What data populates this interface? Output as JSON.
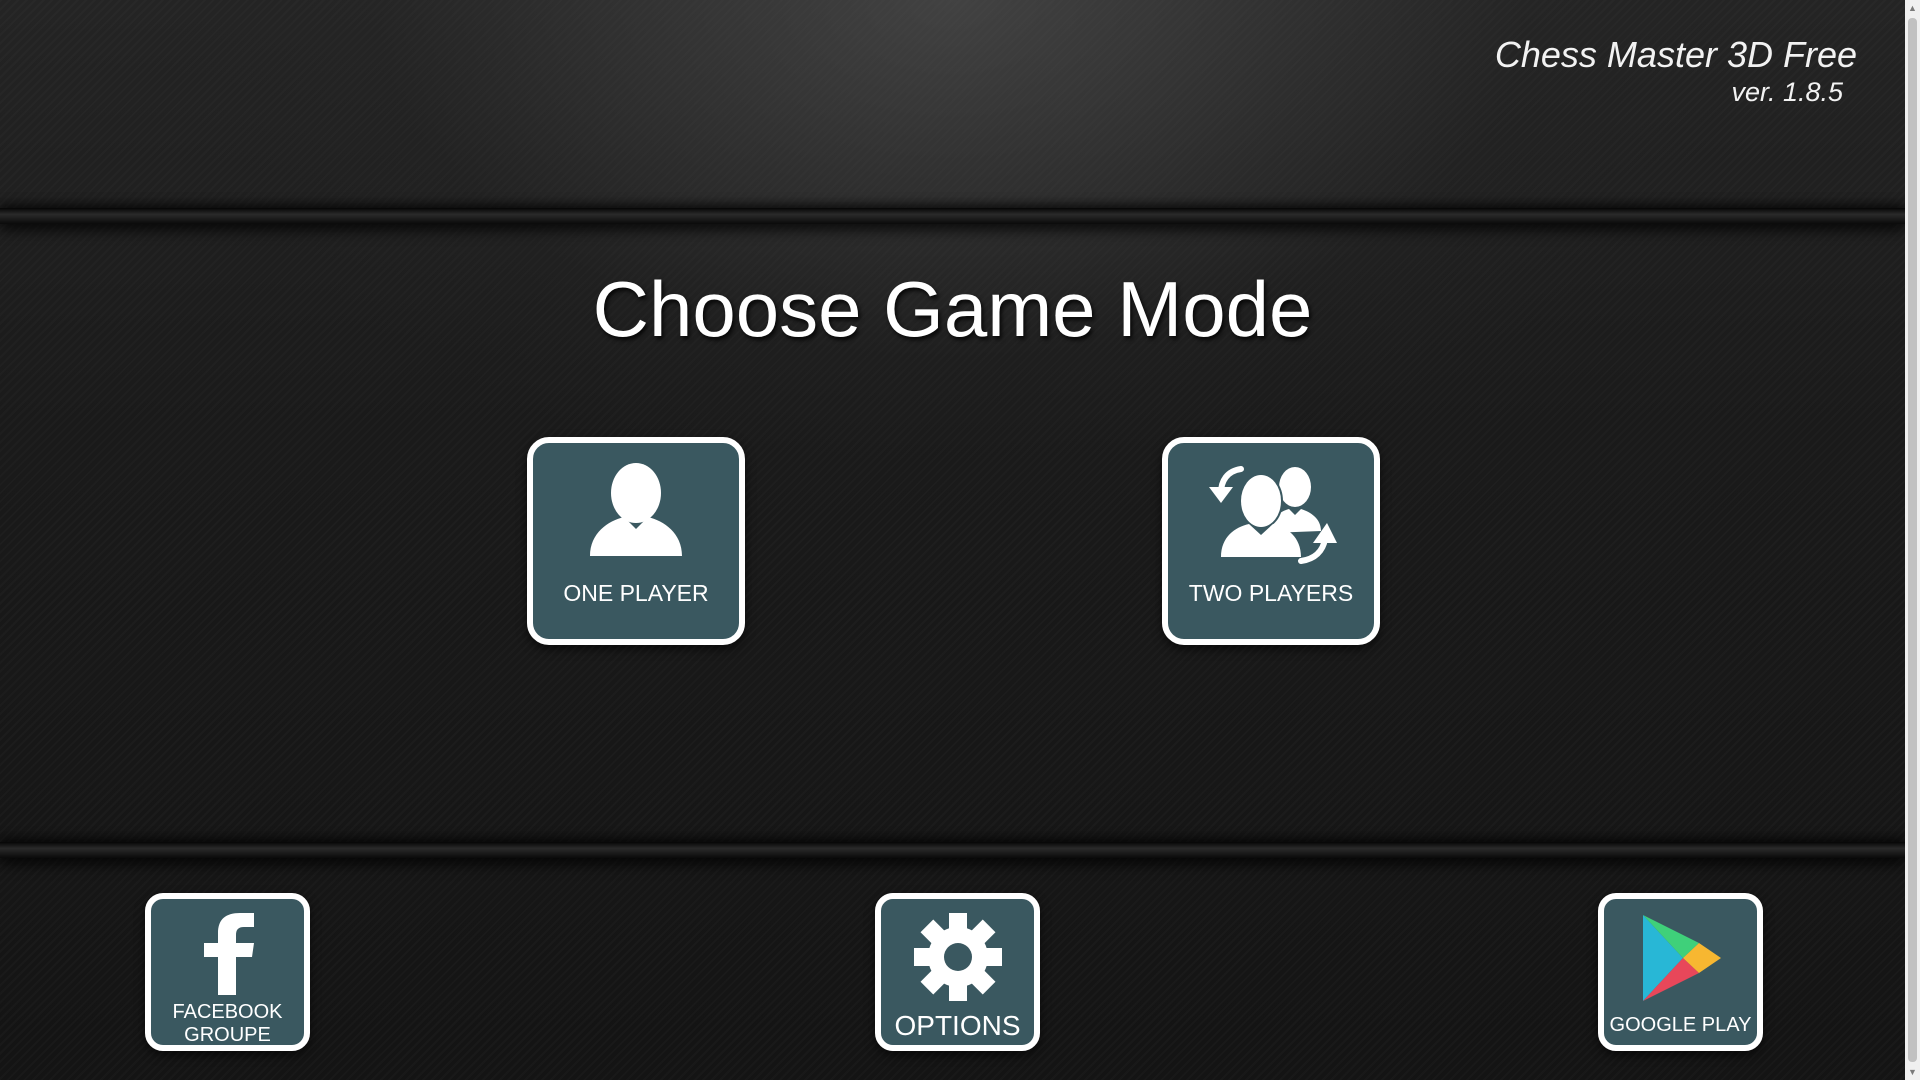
{
  "app": {
    "title": "Chess Master 3D Free",
    "version": "ver. 1.8.5"
  },
  "heading": "Choose Game Mode",
  "modes": [
    {
      "label": "ONE PLAYER",
      "icon": "single-user-icon"
    },
    {
      "label": "TWO PLAYERS",
      "icon": "two-users-swap-icon"
    }
  ],
  "footer": {
    "facebook": {
      "label": "FACEBOOK GROUPE",
      "icon": "facebook-icon"
    },
    "options": {
      "label": "OPTIONS",
      "icon": "gear-icon"
    },
    "google_play": {
      "label": "GOOGLE PLAY",
      "icon": "google-play-icon"
    }
  },
  "colors": {
    "tile_fill": "#3a5860",
    "tile_border": "#ffffff",
    "text": "#ffffff",
    "background": "#1a1a1a"
  }
}
